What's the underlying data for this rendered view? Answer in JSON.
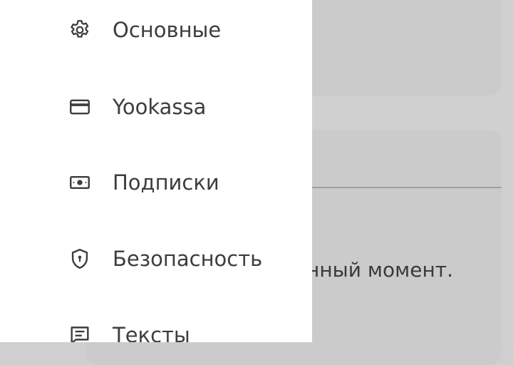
{
  "background": {
    "text_fragment": "нный момент."
  },
  "drawer": {
    "items": [
      {
        "label": "Основные",
        "icon": "gear-icon"
      },
      {
        "label": "Yookassa",
        "icon": "credit-card-icon"
      },
      {
        "label": "Подписки",
        "icon": "banknote-icon"
      },
      {
        "label": "Безопасность",
        "icon": "shield-lock-icon"
      },
      {
        "label": "Тексты",
        "icon": "message-text-icon"
      }
    ]
  },
  "colors": {
    "drawer_bg": "#ffffff",
    "scrim": "#cfcfcf",
    "text": "#3d3d3d"
  }
}
